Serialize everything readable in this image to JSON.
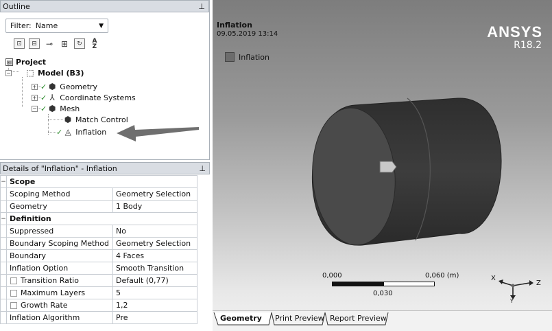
{
  "outline": {
    "title": "Outline",
    "pin_glyph": "ꟷ",
    "filter_label": "Filter:",
    "filter_value": "Name",
    "toolbar_icons": [
      "expand-tree-icon",
      "collapse-tree-icon",
      "link-icon",
      "plus-box-icon",
      "refresh-icon",
      "sort-az-icon"
    ],
    "tree": {
      "project": "Project",
      "model": "Model (B3)",
      "geometry": "Geometry",
      "coordinate_systems": "Coordinate Systems",
      "mesh": "Mesh",
      "match_control": "Match Control",
      "inflation": "Inflation"
    }
  },
  "details": {
    "title": "Details of \"Inflation\" - Inflation",
    "rows": [
      {
        "type": "group",
        "name": "Scope"
      },
      {
        "name": "Scoping Method",
        "value": "Geometry Selection"
      },
      {
        "name": "Geometry",
        "value": "1 Body"
      },
      {
        "type": "group",
        "name": "Definition"
      },
      {
        "name": "Suppressed",
        "value": "No"
      },
      {
        "name": "Boundary Scoping Method",
        "value": "Geometry Selection"
      },
      {
        "name": "Boundary",
        "value": "4 Faces"
      },
      {
        "name": "Inflation Option",
        "value": "Smooth Transition"
      },
      {
        "name": "Transition Ratio",
        "value": "Default (0,77)",
        "indent": true
      },
      {
        "name": "Maximum Layers",
        "value": "5",
        "indent": true
      },
      {
        "name": "Growth Rate",
        "value": "1,2",
        "indent": true
      },
      {
        "name": "Inflation Algorithm",
        "value": "Pre"
      }
    ]
  },
  "viewport": {
    "title": "Inflation",
    "datetime": "09.05.2019 13:14",
    "legend_label": "Inflation",
    "brand": "ANSYS",
    "version": "R18.2",
    "scale_left": "0,000",
    "scale_right": "0,060 (m)",
    "scale_mid": "0,030",
    "axis_x": "X",
    "axis_y": "Y",
    "axis_z": "Z",
    "tabs": [
      "Geometry",
      "Print Preview",
      "Report Preview"
    ]
  },
  "colors": {
    "panel_header": "#d9dde3",
    "cylinder": "#3e3e3e",
    "arrow": "#6f6f6f"
  }
}
